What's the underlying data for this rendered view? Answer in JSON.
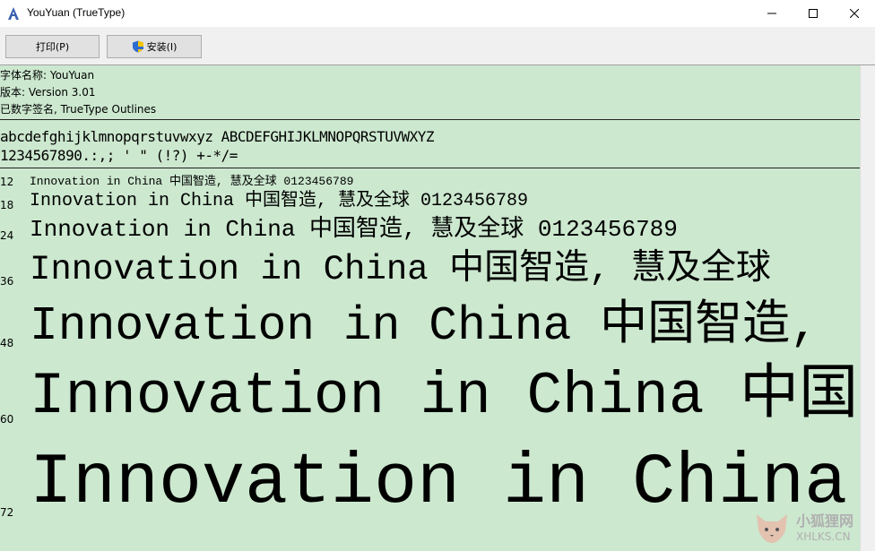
{
  "window": {
    "title": "YouYuan (TrueType)",
    "min_symbol": "—",
    "max_symbol": "☐",
    "close_symbol": "✕"
  },
  "toolbar": {
    "print_label": "打印(P)",
    "install_label": "安装(I)"
  },
  "info": {
    "font_name": "字体名称: YouYuan",
    "version": "版本: Version 3.01",
    "signature": "已数字签名, TrueType Outlines"
  },
  "charset": {
    "letters": "abcdefghijklmnopqrstuvwxyz ABCDEFGHIJKLMNOPQRSTUVWXYZ",
    "symbols": "1234567890.:,; ' \" (!?) +-*/="
  },
  "samples": [
    {
      "size": "12",
      "text": "Innovation in China 中国智造, 慧及全球 0123456789"
    },
    {
      "size": "18",
      "text": "Innovation in China 中国智造, 慧及全球 0123456789"
    },
    {
      "size": "24",
      "text": "Innovation in China 中国智造, 慧及全球 0123456789"
    },
    {
      "size": "36",
      "text": "Innovation in China 中国智造, 慧及全球"
    },
    {
      "size": "48",
      "text": "Innovation in China 中国智造,"
    },
    {
      "size": "60",
      "text": "Innovation in China 中国"
    },
    {
      "size": "72",
      "text": "Innovation in China"
    }
  ],
  "watermark": {
    "text": "小狐狸网",
    "sub": "XHLKS.CN"
  }
}
